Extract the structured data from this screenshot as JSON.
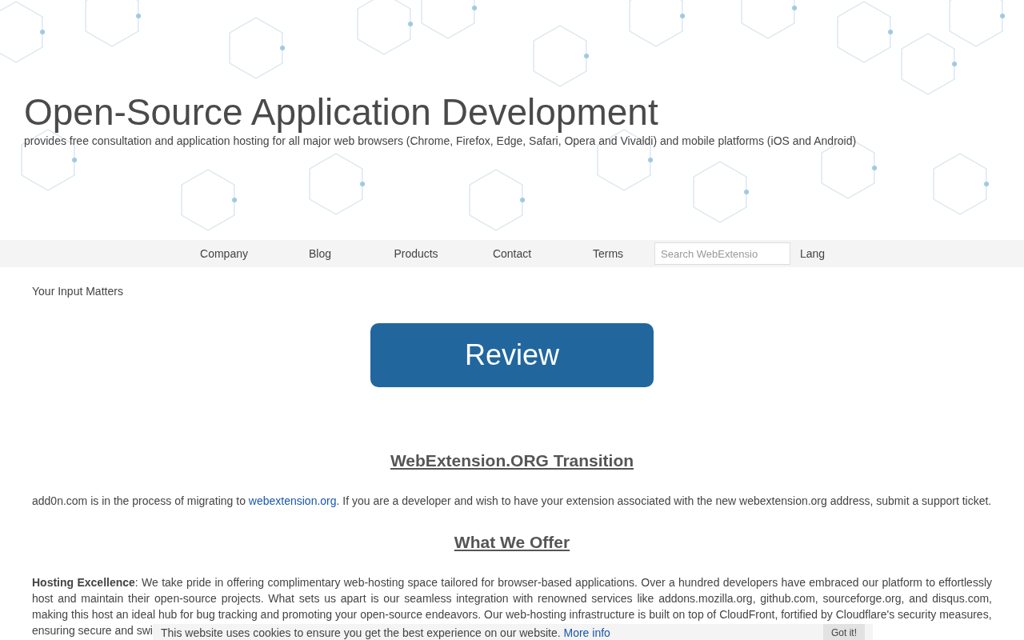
{
  "hero": {
    "title": "Open-Source Application Development",
    "subtitle": "provides free consultation and application hosting for all major web browsers (Chrome, Firefox, Edge, Safari, Opera and Vivaldi) and mobile platforms (iOS and Android)"
  },
  "nav": {
    "items": [
      "Company",
      "Blog",
      "Products",
      "Contact",
      "Terms"
    ],
    "search": {
      "placeholder": "Search WebExtensio"
    },
    "lang": "Lang"
  },
  "intro": "Your Input Matters",
  "review_button": "Review",
  "sections": [
    {
      "heading": "WebExtension.ORG Transition",
      "paragraph": {
        "before": "add0n.com is in the process of migrating to ",
        "link": "webextension.org",
        "after": ". If you are a developer and wish to have your extension associated with the new webextension.org address, submit a support ticket."
      }
    },
    {
      "heading": "What We Offer",
      "paragraph": {
        "text": "**Hosting Excellence**: We take pride in offering complimentary web-hosting space tailored for browser-based applications. Over a hundred developers have embraced our platform to effortlessly host and maintain their open-source projects. What sets us apart is our seamless integration with renowned services like addons.mozilla.org, github.com, sourceforge.org, and disqus.com, making this host an ideal hub for bug tracking and promoting your open-source endeavors. Our web-hosting infrastructure is built on top of CloudFront, fortified by Cloudflare's security measures,",
        "last_line": "ensuring secure and swi"
      }
    }
  ],
  "cookie_banner": {
    "text": "This website uses cookies to ensure you get the best experience on our website.",
    "link": "More info",
    "button": "Got it!"
  }
}
